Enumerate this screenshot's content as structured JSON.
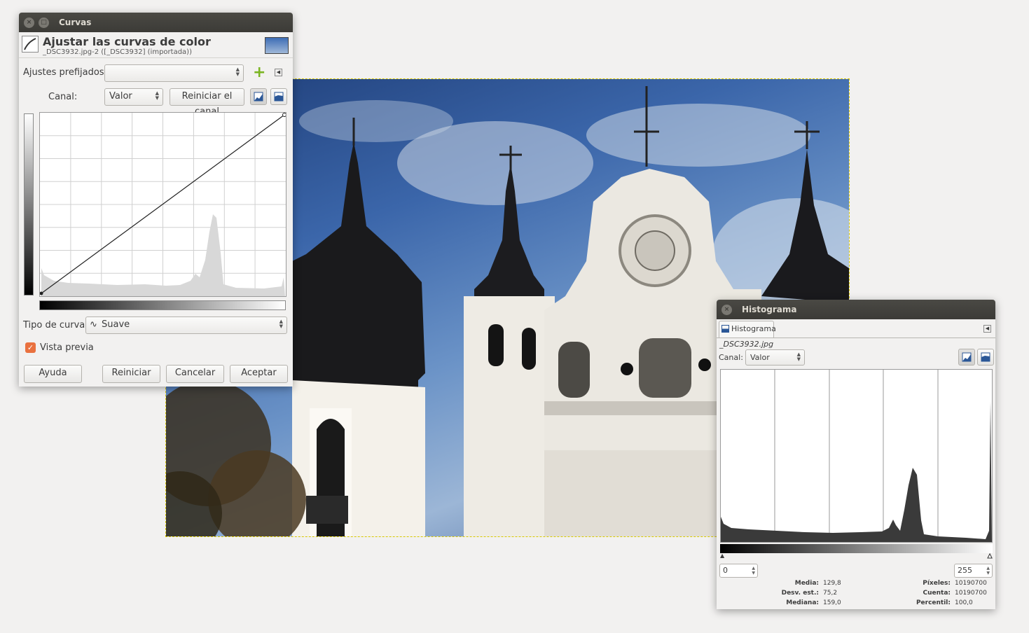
{
  "curves_dialog": {
    "window_title": "Curvas",
    "heading": "Ajustar las curvas de color",
    "subheading": "_DSC3932.jpg-2 ([_DSC3932] (importada))",
    "presets_label": "Ajustes prefijados:",
    "presets_value": "",
    "channel_label": "Canal:",
    "channel_value": "Valor",
    "reset_channel": "Reiniciar el canal",
    "curve_type_label": "Tipo de curva:",
    "curve_type_value": "Suave",
    "preview_label": "Vista previa",
    "preview_checked": true,
    "buttons": {
      "help": "Ayuda",
      "reset": "Reiniciar",
      "cancel": "Cancelar",
      "ok": "Aceptar"
    },
    "icons": [
      "curves-tool-icon",
      "image-thumbnail-icon",
      "add-preset-icon",
      "preset-menu-icon",
      "linear-histogram-icon",
      "log-histogram-icon",
      "smooth-curve-icon"
    ],
    "accent_color": "#e9713f"
  },
  "histogram_dialog": {
    "window_title": "Histograma",
    "tab_label": "Histograma",
    "image_name": "_DSC3932.jpg",
    "channel_label": "Canal:",
    "channel_value": "Valor",
    "range_low": "0",
    "range_high": "255",
    "stats": {
      "mean_label": "Media:",
      "mean_value": "129,8",
      "stddev_label": "Desv. est.:",
      "stddev_value": "75,2",
      "median_label": "Mediana:",
      "median_value": "159,0",
      "pixels_label": "Píxeles:",
      "pixels_value": "10190700",
      "count_label": "Cuenta:",
      "count_value": "10190700",
      "percentile_label": "Percentil:",
      "percentile_value": "100,0"
    }
  },
  "canvas": {
    "description_icon": "church-photo"
  }
}
